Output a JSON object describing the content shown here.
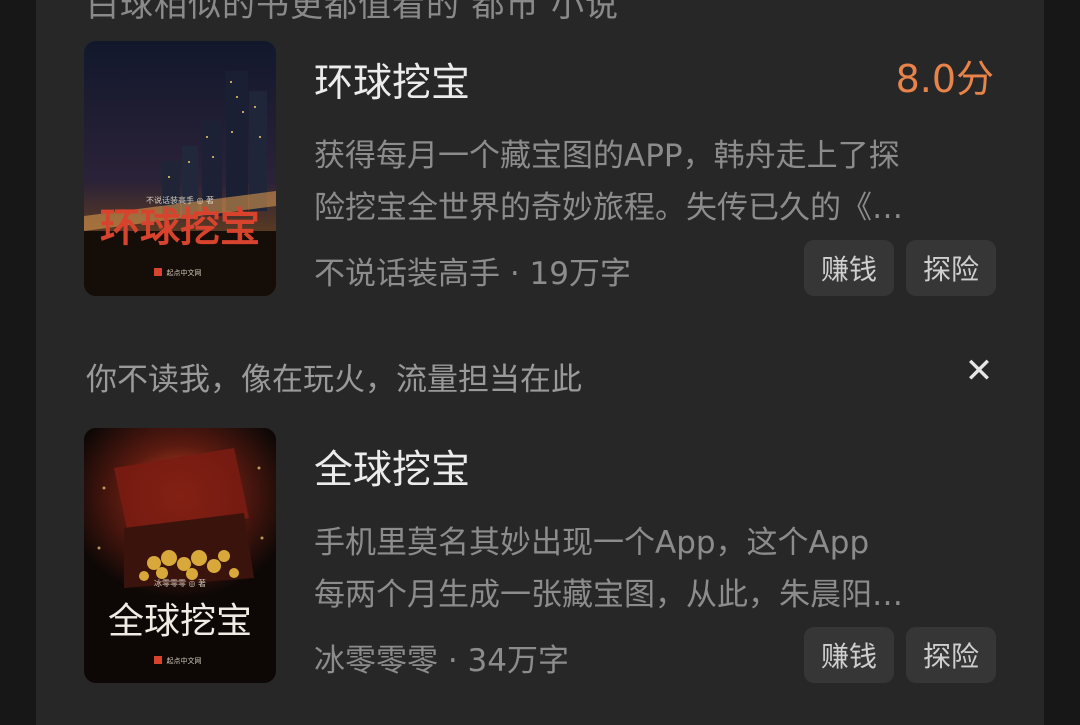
{
  "header_partial": "白球相似的书更都值看的 都市 小说",
  "books": [
    {
      "title": "环球挖宝",
      "score": "8.0分",
      "desc_line1": "获得每月一个藏宝图的APP，韩舟走上了探",
      "desc_line2": "险挖宝全世界的奇妙旅程。失传已久的《…",
      "meta": "不说话装高手 · 19万字",
      "tags": [
        "赚钱",
        "探险"
      ],
      "cover": {
        "title": "环球挖宝",
        "author": "不说话装高手 ◎ 著",
        "publisher": "起点中文网"
      }
    },
    {
      "title": "全球挖宝",
      "desc_line1": "手机里莫名其妙出现一个App，这个App",
      "desc_line2": "每两个月生成一张藏宝图，从此，朱晨阳…",
      "meta": "冰零零零 · 34万字",
      "tags": [
        "赚钱",
        "探险"
      ],
      "cover": {
        "title": "全球挖宝",
        "author": "冰零零零 ◎ 著",
        "publisher": "起点中文网"
      }
    }
  ],
  "recommendation_text": "你不读我，像在玩火，流量担当在此",
  "close_symbol": "✕",
  "colors": {
    "score": "#e8834a",
    "background": "#272727",
    "tag_bg": "#363636"
  }
}
